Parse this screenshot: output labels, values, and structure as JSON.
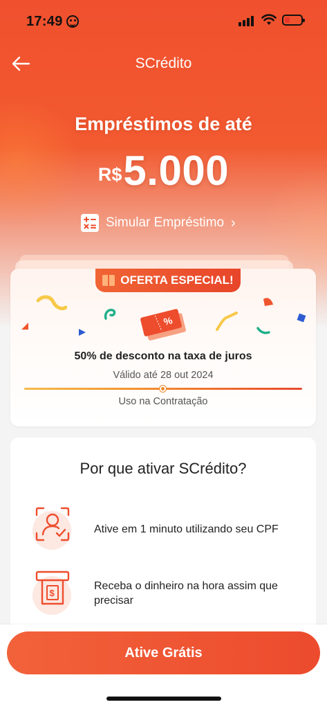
{
  "status_bar": {
    "time": "17:49"
  },
  "nav": {
    "title": "SCrédito"
  },
  "hero": {
    "headline": "Empréstimos de até",
    "currency": "R$",
    "amount": "5.000",
    "simulate_label": "Simular Empréstimo",
    "simulate_chevron": "›"
  },
  "offer": {
    "badge": "OFERTA ESPECIAL!",
    "title": "50% de desconto na taxa de juros",
    "valid": "Válido até 28 out 2024",
    "usage": "Uso na Contratação",
    "coupon_symbol": "%"
  },
  "why": {
    "title": "Por que ativar SCrédito?",
    "benefits": [
      {
        "icon": "face-id-icon",
        "text": "Ative em 1 minuto utilizando seu CPF"
      },
      {
        "icon": "atm-cash-icon",
        "text": "Receba o dinheiro na hora assim que precisar",
        "symbol": "$"
      }
    ]
  },
  "cta": {
    "label": "Ative Grátis"
  },
  "colors": {
    "brand": "#ee4d2d",
    "accent": "#f2623a",
    "text": "#222222"
  }
}
